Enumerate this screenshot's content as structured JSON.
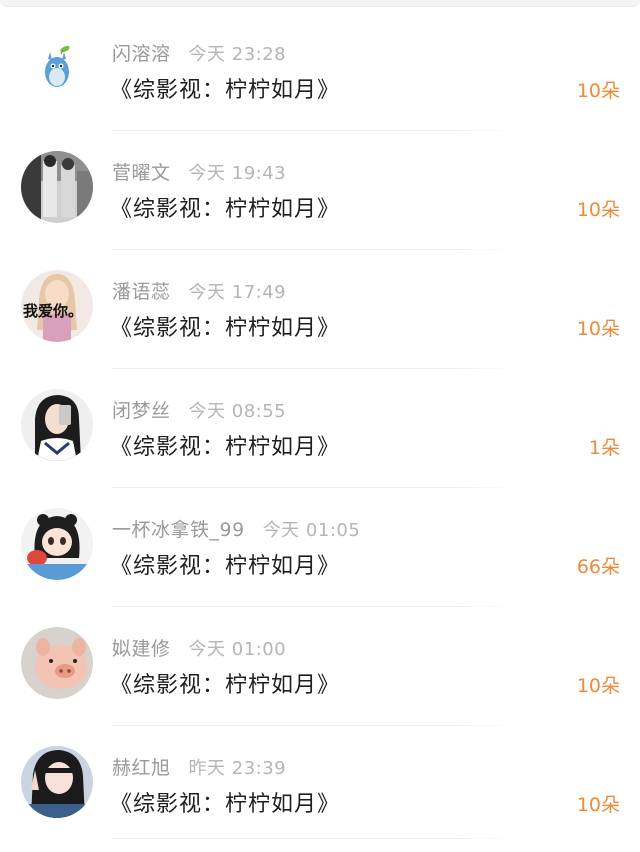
{
  "gifts": [
    {
      "name": "闪溶溶",
      "time": "今天 23:28",
      "title": "《综影视：柠柠如月》",
      "count": "10朵",
      "avatar": "totoro-avatar"
    },
    {
      "name": "菅曜文",
      "time": "今天 19:43",
      "title": "《综影视：柠柠如月》",
      "count": "10朵",
      "avatar": "couple-photo-avatar"
    },
    {
      "name": "潘语蕊",
      "time": "今天 17:49",
      "title": "《综影视：柠柠如月》",
      "count": "10朵",
      "avatar": "girl-love-text-avatar",
      "avatar_text": "我爱你。"
    },
    {
      "name": "闭梦丝",
      "time": "今天 08:55",
      "title": "《综影视：柠柠如月》",
      "count": "1朵",
      "avatar": "selfie-girl-avatar"
    },
    {
      "name": "一杯冰拿铁_99",
      "time": "今天 01:05",
      "title": "《综影视：柠柠如月》",
      "count": "66朵",
      "avatar": "anime-girl-avatar"
    },
    {
      "name": "姒建修",
      "time": "今天 01:00",
      "title": "《综影视：柠柠如月》",
      "count": "10朵",
      "avatar": "pig-avatar"
    },
    {
      "name": "赫红旭",
      "time": "昨天 23:39",
      "title": "《综影视：柠柠如月》",
      "count": "10朵",
      "avatar": "peace-sign-girl-avatar"
    }
  ],
  "colors": {
    "count": "#ef8a38",
    "name": "#9a9a9a",
    "time": "#b5b5b5",
    "title": "#1f1f1f"
  }
}
